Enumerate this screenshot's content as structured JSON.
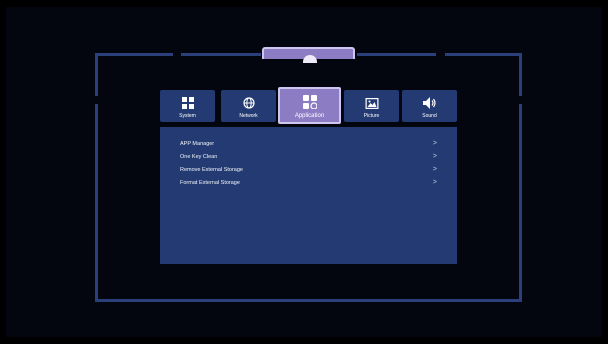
{
  "tabs": [
    {
      "label": "System",
      "icon": "system-icon",
      "active": false
    },
    {
      "label": "Network",
      "icon": "globe-icon",
      "active": false
    },
    {
      "label": "Application",
      "icon": "apps-icon",
      "active": true
    },
    {
      "label": "Picture",
      "icon": "picture-icon",
      "active": false
    },
    {
      "label": "Sound",
      "icon": "speaker-icon",
      "active": false
    }
  ],
  "menu": {
    "items": [
      {
        "label": "APP Manager",
        "chevron": ">"
      },
      {
        "label": "One Key Clean",
        "chevron": ">"
      },
      {
        "label": "Remove External Storage",
        "chevron": ">"
      },
      {
        "label": "Format External Storage",
        "chevron": ">"
      }
    ]
  },
  "colors": {
    "frame": "#2b3f7a",
    "panel": "#233a72",
    "active_tab": "#8b7cc4",
    "active_tab_border": "#cfc6ee",
    "background": "#03060e"
  }
}
